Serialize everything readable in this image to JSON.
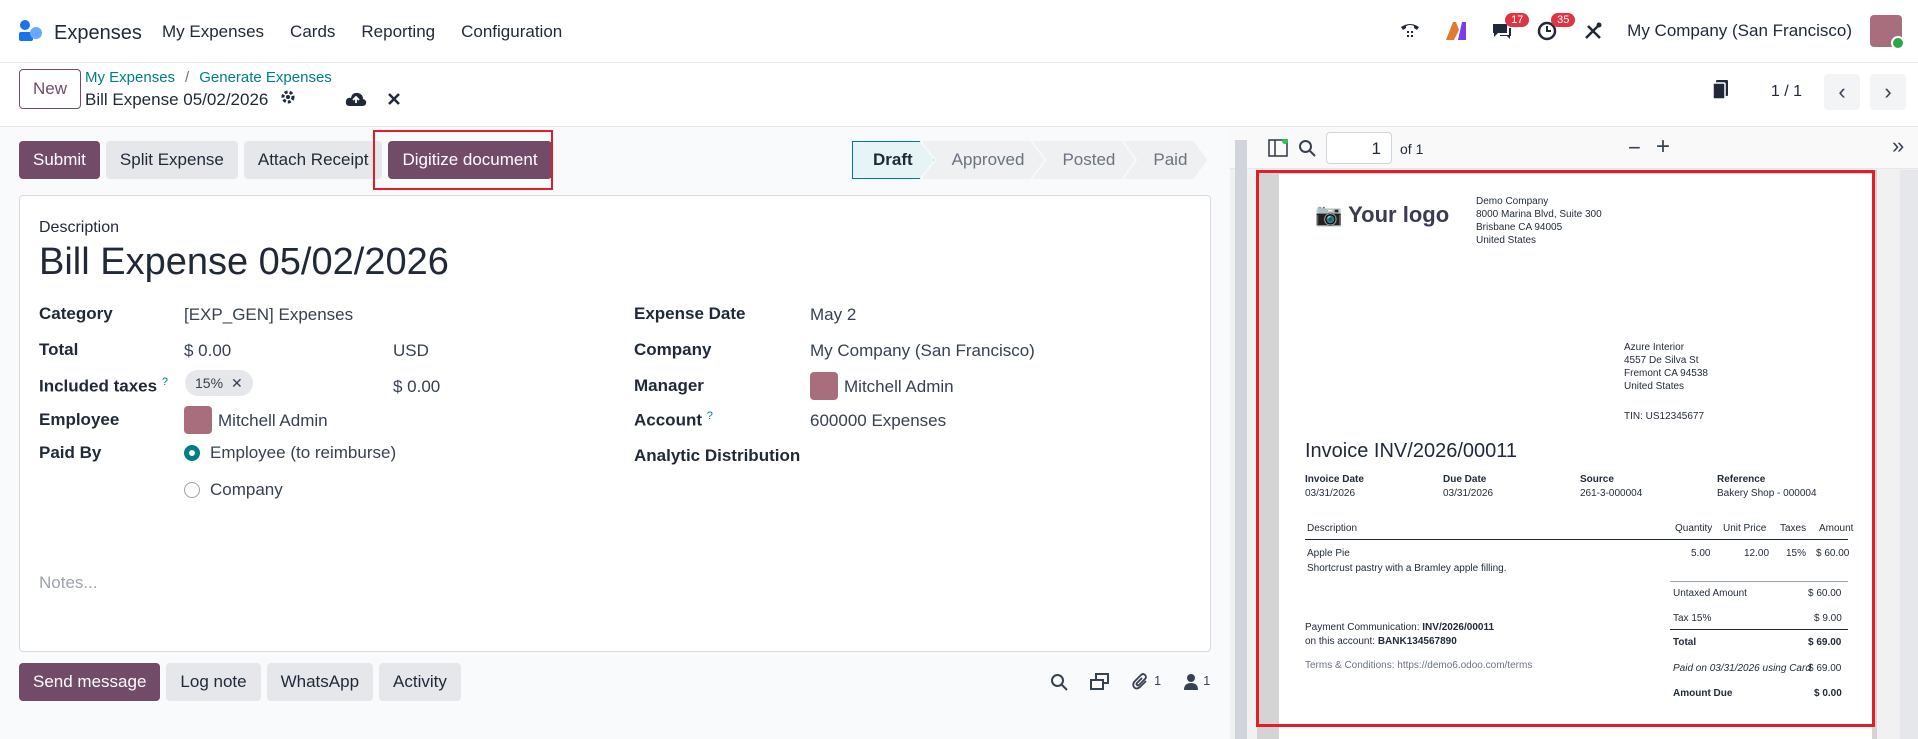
{
  "topbar": {
    "app_name": "Expenses",
    "menu": [
      "My Expenses",
      "Cards",
      "Reporting",
      "Configuration"
    ],
    "chat_badge": "17",
    "activity_badge": "35",
    "company": "My Company (San Francisco)"
  },
  "control": {
    "new_label": "New",
    "breadcrumb": [
      "My Expenses",
      "Generate Expenses"
    ],
    "breadcrumb_sep": "/",
    "record_title": "Bill Expense 05/02/2026",
    "pager": "1 / 1"
  },
  "actions": {
    "buttons": [
      "Submit",
      "Split Expense",
      "Attach Receipt",
      "Digitize document"
    ],
    "stages": [
      "Draft",
      "Approved",
      "Posted",
      "Paid"
    ],
    "active_stage": "Draft"
  },
  "form": {
    "description_label": "Description",
    "description_value": "Bill Expense 05/02/2026",
    "category_label": "Category",
    "category_value": "[EXP_GEN] Expenses",
    "total_label": "Total",
    "total_value": "$ 0.00",
    "currency": "USD",
    "taxes_label": "Included taxes",
    "help_mark": "?",
    "tax_tag": "15%",
    "tax_amount": "$ 0.00",
    "employee_label": "Employee",
    "employee_value": "Mitchell Admin",
    "paid_by_label": "Paid By",
    "paid_by_options": [
      "Employee (to reimburse)",
      "Company"
    ],
    "paid_by_selected": "Employee (to reimburse)",
    "expense_date_label": "Expense Date",
    "expense_date_value": "May 2",
    "company_label": "Company",
    "company_value": "My Company (San Francisco)",
    "manager_label": "Manager",
    "manager_value": "Mitchell Admin",
    "account_label": "Account",
    "account_value": "600000 Expenses",
    "analytic_label": "Analytic Distribution",
    "notes_placeholder": "Notes..."
  },
  "chatter": {
    "buttons": [
      "Send message",
      "Log note",
      "WhatsApp",
      "Activity"
    ],
    "attachments_count": "1",
    "followers_count": "1"
  },
  "preview": {
    "page_value": "1",
    "page_of": "of 1",
    "logo_text": "Your logo",
    "company_address": [
      "Demo Company",
      "8000 Marina Blvd, Suite 300",
      "Brisbane CA 94005",
      "United States"
    ],
    "customer_address": [
      "Azure Interior",
      "4557 De Silva St",
      "Fremont CA 94538",
      "United States"
    ],
    "tin": "TIN: US12345677",
    "invoice_title": "Invoice INV/2026/00011",
    "info_headers": [
      "Invoice Date",
      "Due Date",
      "Source",
      "Reference"
    ],
    "info_values": [
      "03/31/2026",
      "03/31/2026",
      "261-3-000004",
      "Bakery Shop - 000004"
    ],
    "line_headers": [
      "Description",
      "Quantity",
      "Unit Price",
      "Taxes",
      "Amount"
    ],
    "line": {
      "name": "Apple Pie",
      "desc": "Shortcrust pastry with a Bramley apple filling.",
      "qty": "5.00",
      "price": "12.00",
      "tax": "15%",
      "amount": "$ 60.00"
    },
    "totals": [
      {
        "label": "Untaxed Amount",
        "value": "$ 60.00"
      },
      {
        "label": "Tax 15%",
        "value": "$ 9.00"
      },
      {
        "label": "Total",
        "value": "$ 69.00"
      },
      {
        "label": "Paid on 03/31/2026 using Card",
        "value": "$ 69.00"
      },
      {
        "label": "Amount Due",
        "value": "$ 0.00"
      }
    ],
    "payment_comm_label": "Payment Communication:",
    "payment_comm_value": "INV/2026/00011",
    "account_label": "on this account:",
    "account_value": "BANK134567890",
    "terms": "Terms & Conditions: https://demo6.odoo.com/terms"
  },
  "colors": {
    "primary": "#714b67",
    "accent": "#017e84",
    "highlight": "#e11d2b"
  }
}
